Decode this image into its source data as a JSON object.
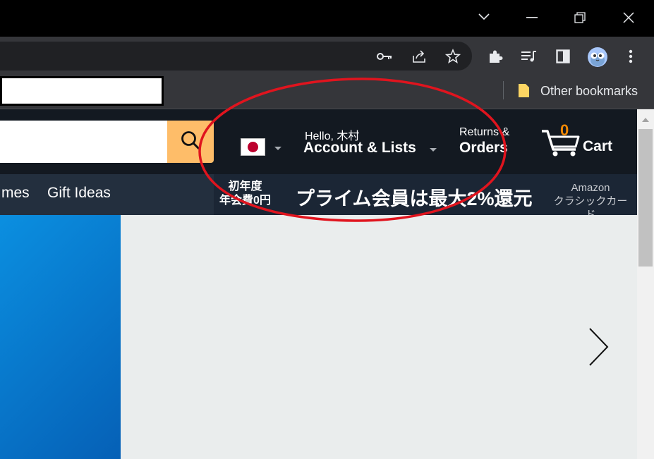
{
  "browser": {
    "bookmarks_bar": {
      "other_bookmarks_label": "Other bookmarks"
    }
  },
  "amazon": {
    "header": {
      "account": {
        "greeting": "Hello, 木村",
        "label": "Account & Lists"
      },
      "returns": {
        "line1": "Returns &",
        "line2": "Orders"
      },
      "cart": {
        "count": "0",
        "label": "Cart"
      }
    },
    "subnav": {
      "items": [
        {
          "label": "mes"
        },
        {
          "label": "Gift Ideas"
        }
      ],
      "promo": {
        "small_line1": "初年度",
        "small_line2": "年会費0円",
        "main": "プライム会員は最大2%還元",
        "side_line1": "Amazon",
        "side_line2": "クラシックカード"
      }
    }
  },
  "colors": {
    "amazon_dark": "#131921",
    "amazon_subnav": "#232f3e",
    "search_button": "#febd69",
    "cart_count": "#f08804",
    "annotation": "#e0141e"
  }
}
